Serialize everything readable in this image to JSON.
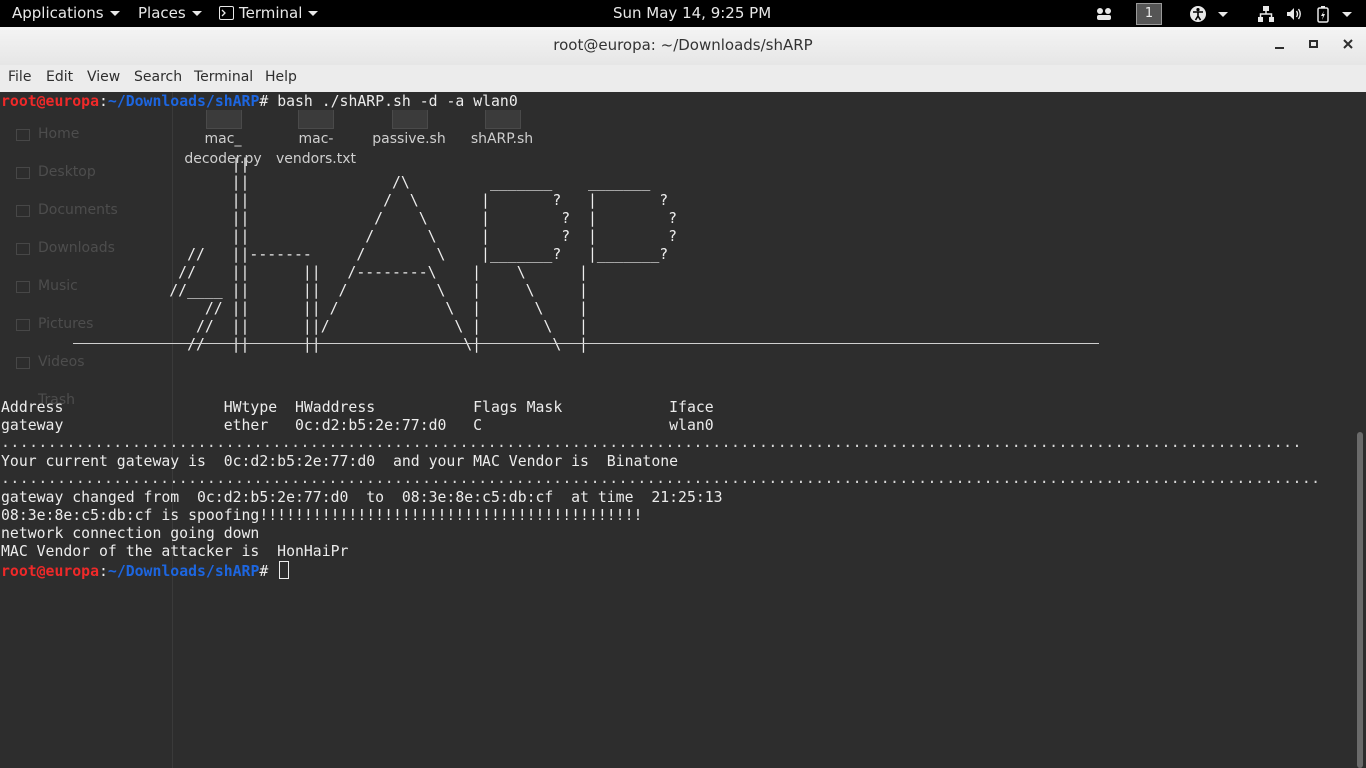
{
  "topbar": {
    "applications": "Applications",
    "places": "Places",
    "terminal": "Terminal",
    "clock": "Sun May 14,  9:25 PM",
    "workspace": "1"
  },
  "window": {
    "title": "root@europa: ~/Downloads/shARP"
  },
  "menubar": [
    "File",
    "Edit",
    "View",
    "Search",
    "Terminal",
    "Help"
  ],
  "ghost": {
    "sidebar": [
      "Home",
      "Desktop",
      "Documents",
      "Downloads",
      "Music",
      "Pictures",
      "Videos",
      "Trash"
    ],
    "files": [
      {
        "name": "mac_\ndecoder.py"
      },
      {
        "name": "mac-\nvendors.txt"
      },
      {
        "name": "passive.sh"
      },
      {
        "name": "shARP.sh"
      }
    ]
  },
  "terminal": {
    "prompt_user": "root@europa",
    "prompt_colon": ":",
    "prompt_path": "~/Downloads/shARP",
    "prompt_symbol": "# ",
    "command": "bash ./shARP.sh -d -a wlan0",
    "art": "                          ||\n                          ||                /\\         _______    _______\n                          ||               /  \\       |       ?   |       ?\n                          ||              /    \\      |        ?  |        ?\n                          ||             /      \\     |        ?  |        ?\n                     //   ||-------     /        \\    |_______?   |_______?\n                    //    ||      ||   /--------\\    |    \\      |\n                   //____ ||      ||  /          \\   |     \\     |\n                       // ||      || /            \\  |      \\    |\n                      //  ||      ||/              \\ |       \\   |\n                     //   ||      ||                \\|        \\  |",
    "table_header": "Address                  HWtype  HWaddress           Flags Mask            Iface",
    "table_row": "gateway                  ether   0c:d2:b5:2e:77:d0   C                     wlan0",
    "dots1": "...........................................................................................................................................",
    "gateway_line": "Your current gateway is  0c:d2:b5:2e:77:d0  and your MAC Vendor is  Binatone",
    "dots2": ".............................................................................................................................................",
    "changed_line": "gateway changed from  0c:d2:b5:2e:77:d0  to  08:3e:8e:c5:db:cf  at time  21:25:13",
    "spoof_line": "08:3e:8e:c5:db:cf is spoofing!!!!!!!!!!!!!!!!!!!!!!!!!!!!!!!!!!!!!!!!!!!",
    "down_line": "network connection going down",
    "vendor_line": "MAC Vendor of the attacker is  HonHaiPr"
  },
  "colors": {
    "prompt_user": "#ef2929",
    "prompt_path": "#1d66e0",
    "terminal_bg": "#2d2d2d",
    "topbar_bg": "#000000"
  }
}
